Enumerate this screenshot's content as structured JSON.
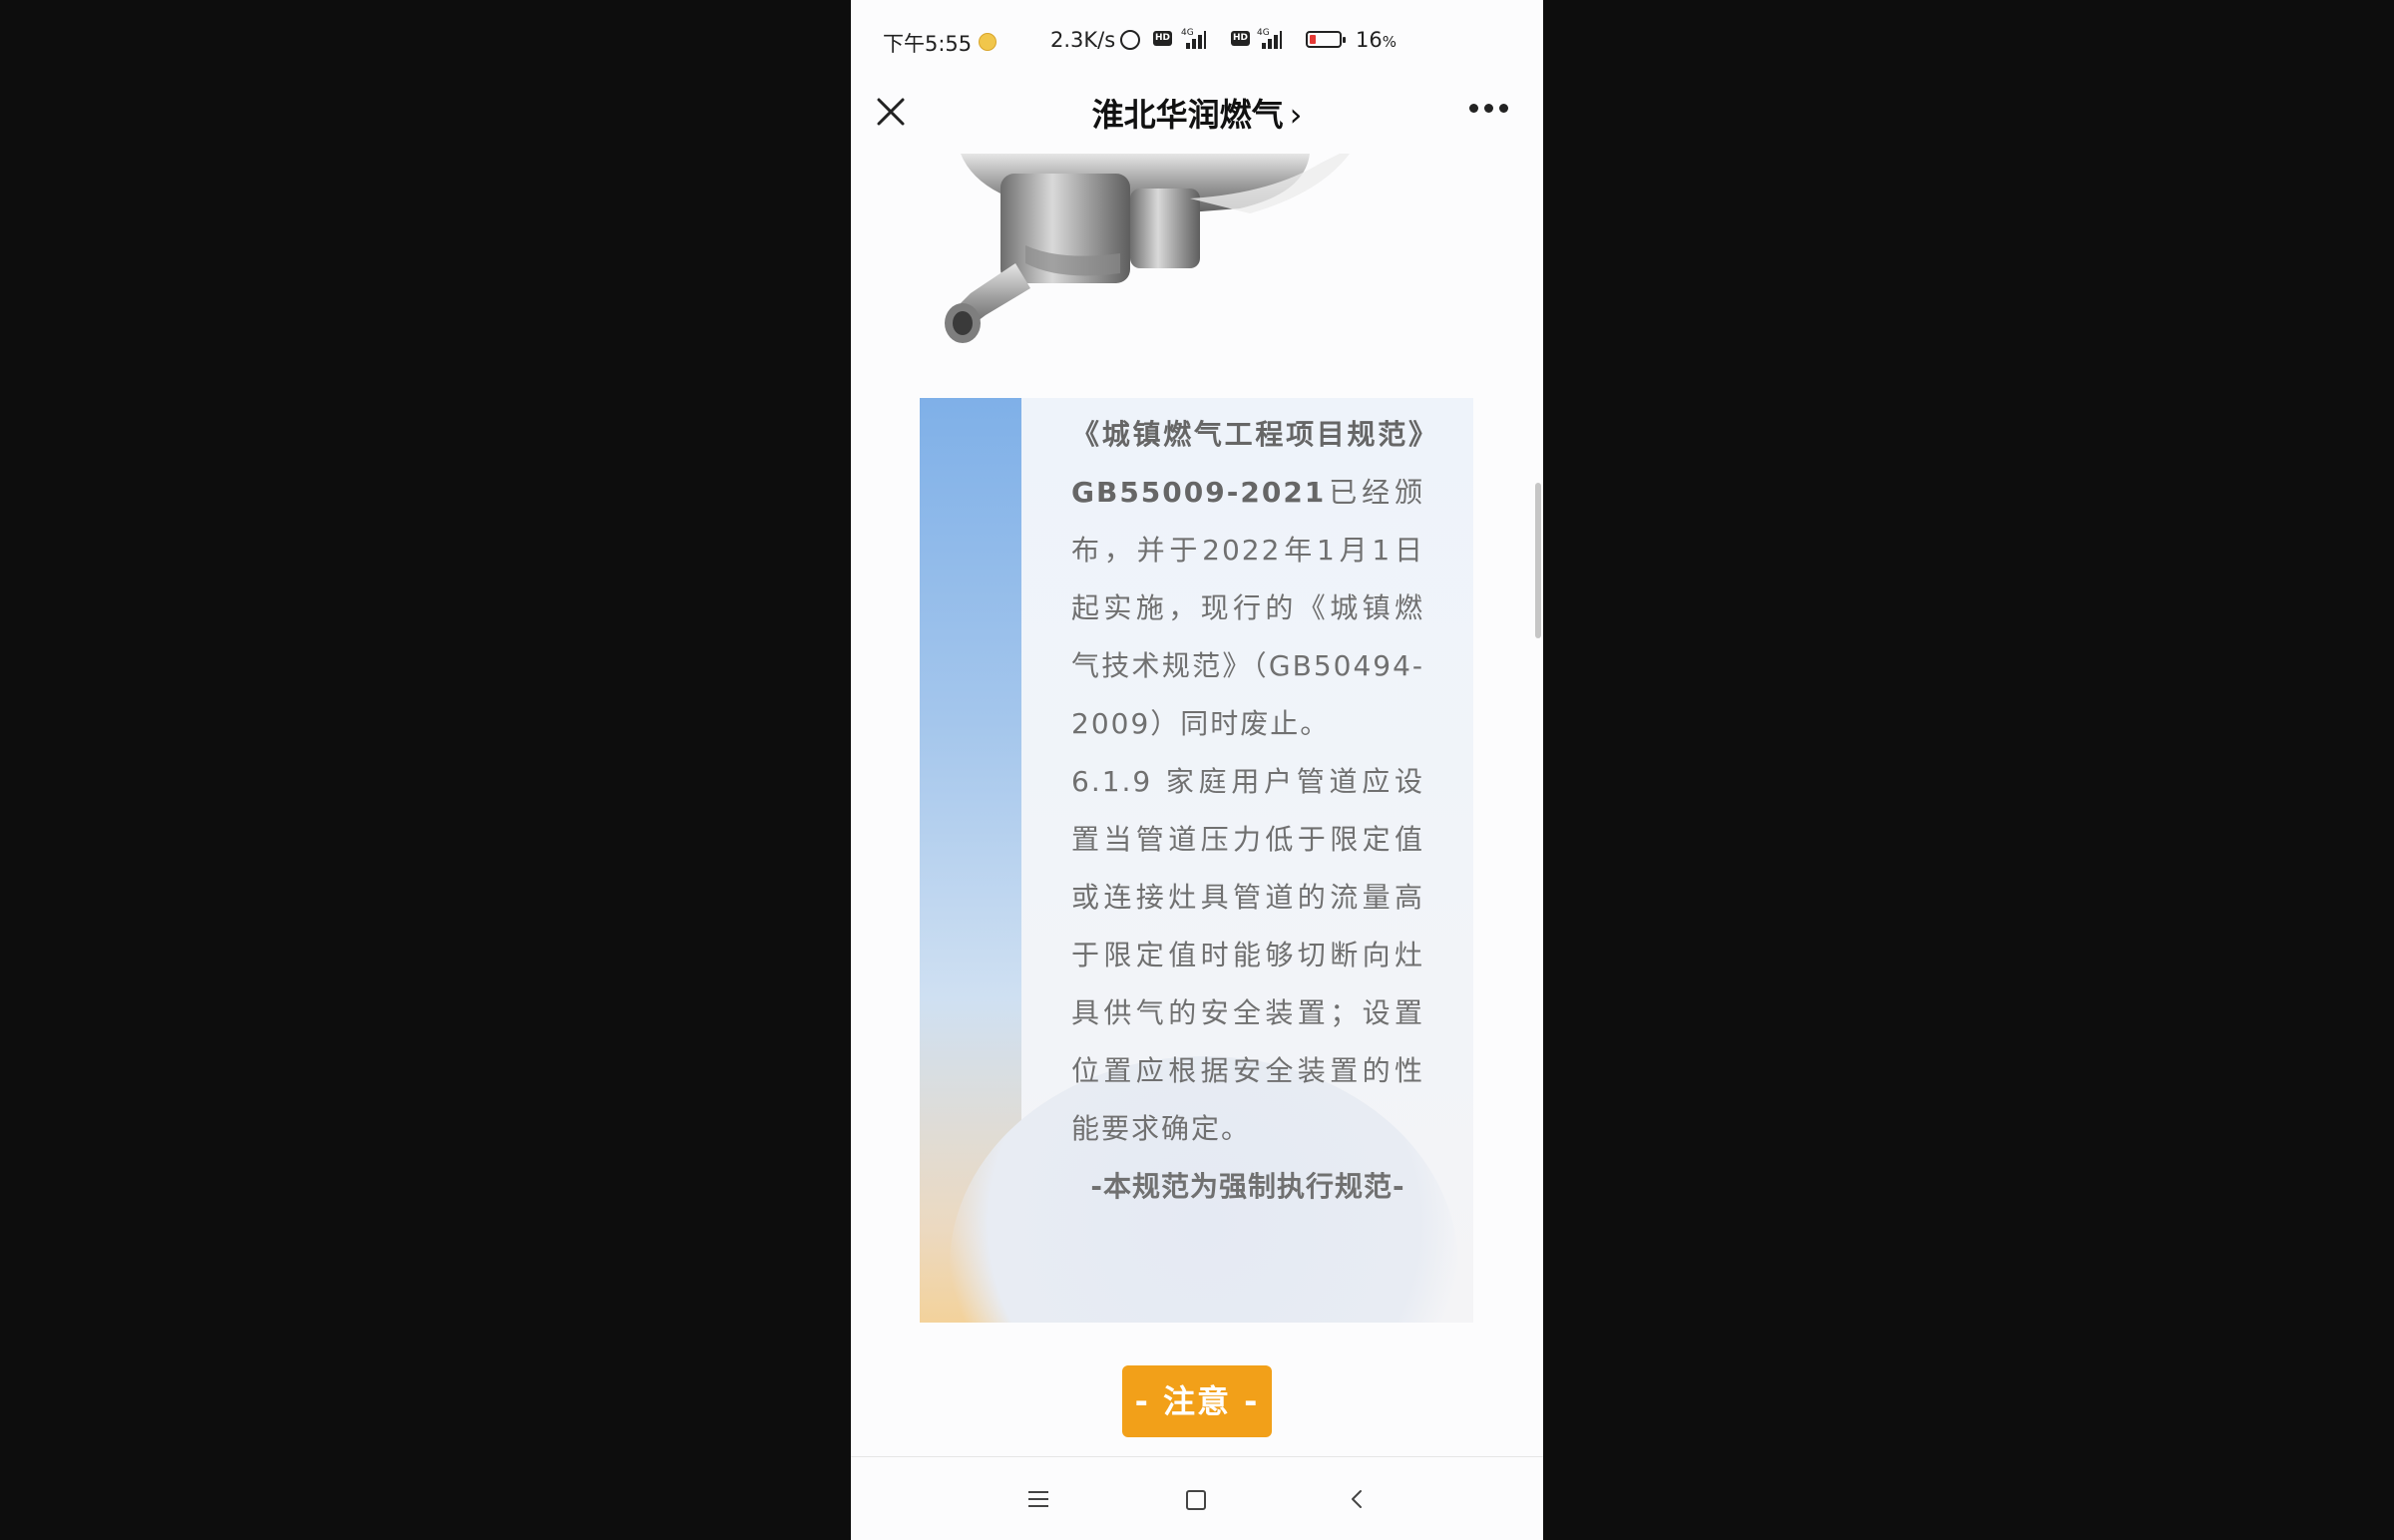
{
  "status_bar": {
    "time": "下午5:55",
    "net_speed": "2.3K/s",
    "sim1_network": "4G",
    "sim2_network": "4G",
    "battery_percent": "16",
    "battery_unit": "%",
    "hd_label": "HD",
    "icons": [
      "coin-icon",
      "alarm-icon",
      "hd-icon",
      "signal-icon",
      "battery-icon"
    ]
  },
  "header": {
    "title": "淮北华润燃气",
    "chevron": "›",
    "icons": [
      "close-icon",
      "more-icon"
    ]
  },
  "article": {
    "card": {
      "lead_bold": "《城镇燃气工程项目规范》GB55009-2021",
      "lead_rest": "已经颁布，并于2022年1月1日起实施，现行的《城镇燃气技术规范》（GB50494-2009）同时废止。",
      "clause": "6.1.9 家庭用户管道应设置当管道压力低于限定值或连接灶具管道的流量高于限定值时能够切断向灶具供气的安全装置；设置位置应根据安全装置的性能要求确定。",
      "footer": "-本规范为强制执行规范-"
    },
    "notice_button": "- 注意 -",
    "accent_color": "#f2a019"
  },
  "nav_bar": {
    "icons": [
      "menu-icon",
      "home-icon",
      "back-icon"
    ]
  }
}
